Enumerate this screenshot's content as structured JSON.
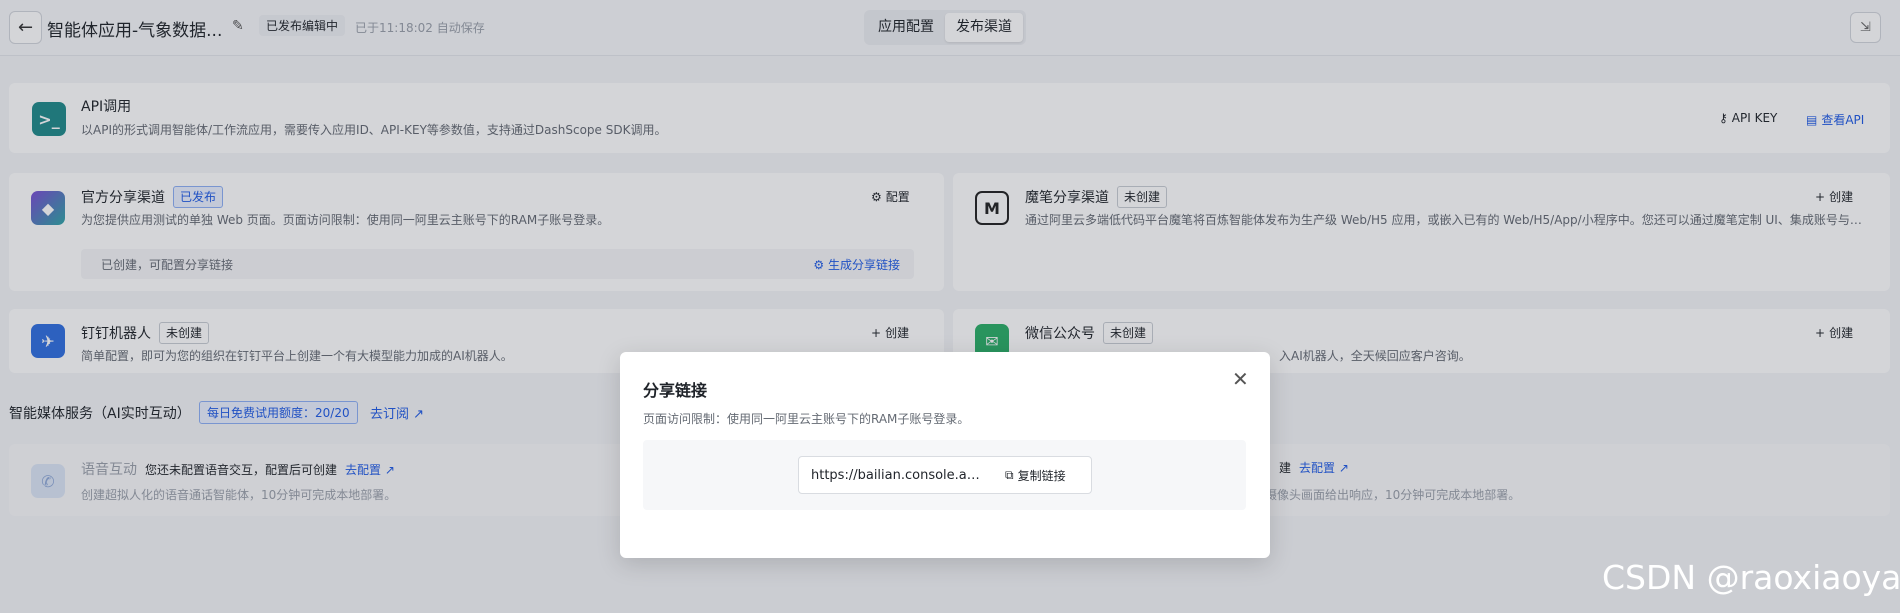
{
  "header": {
    "title": "智能体应用-气象数据...",
    "status_badge": "已发布编辑中",
    "save_text": "已于11:18:02 自动保存",
    "tabs": [
      {
        "label": "应用配置",
        "active": false
      },
      {
        "label": "发布渠道",
        "active": true
      }
    ]
  },
  "api_card": {
    "title": "API调用",
    "desc": "以API的形式调用智能体/工作流应用，需要传入应用ID、API-KEY等参数值，支持通过DashScope SDK调用。",
    "api_key_label": "API KEY",
    "view_api_label": "查看API"
  },
  "official_card": {
    "title": "官方分享渠道",
    "tag": "已发布",
    "desc": "为您提供应用测试的单独 Web 页面。页面访问限制：使用同一阿里云主账号下的RAM子账号登录。",
    "config_label": "配置",
    "sub_text": "已创建，可配置分享链接",
    "sub_link": "生成分享链接"
  },
  "mobi_card": {
    "title": "魔笔分享渠道",
    "tag": "未创建",
    "desc": "通过阿里云多端低代码平台魔笔将百炼智能体发布为生产级 Web/H5 应用，或嵌入已有的 Web/H5/App/小程序中。您还可以通过魔笔定制 UI、集成账号与业...",
    "action": "创建"
  },
  "dingtalk_card": {
    "title": "钉钉机器人",
    "tag": "未创建",
    "desc": "简单配置，即可为您的组织在钉钉平台上创建一个有大模型能力加成的AI机器人。",
    "action": "创建"
  },
  "wechat_card": {
    "title": "微信公众号",
    "tag": "未创建",
    "desc": "入AI机器人，全天候回应客户咨询。",
    "action": "创建"
  },
  "media_section": {
    "title": "智能媒体服务（AI实时互动）",
    "quota": "每日免费试用额度：20/20",
    "subscribe": "去订阅"
  },
  "voice_card": {
    "title": "语音互动",
    "hint": "您还未配置语音交互，配置后可创建",
    "link": "去配置",
    "desc": "创建超拟人化的语音通话智能体，10分钟可完成本地部署。"
  },
  "video_card": {
    "hint_tail": "建",
    "link": "去配置",
    "desc": "摄像头画面给出响应，10分钟可完成本地部署。"
  },
  "modal": {
    "title": "分享链接",
    "desc": "页面访问限制：使用同一阿里云主账号下的RAM子账号登录。",
    "url": "https://bailian.console.aliyun.com/",
    "copy_label": "复制链接"
  },
  "watermark": "CSDN @raoxiaoya",
  "colors": {
    "accent": "#1e5ae6",
    "api_icon": "#1f8a8a",
    "dingtalk_icon": "#2f6fe0",
    "wechat_icon": "#2aae67"
  }
}
